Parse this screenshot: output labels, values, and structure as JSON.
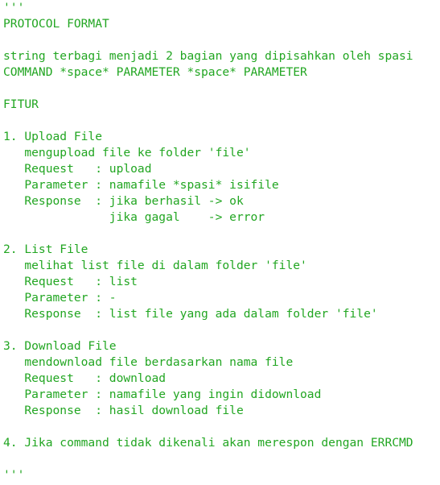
{
  "theme": {
    "text_color": "#22a622",
    "background": "#ffffff"
  },
  "fence_open": "'''",
  "title": "PROTOCOL FORMAT",
  "intro": {
    "line1": "string terbagi menjadi 2 bagian yang dipisahkan oleh spasi",
    "line2": "COMMAND *space* PARAMETER *space* PARAMETER"
  },
  "fitur_heading": "FITUR",
  "features": [
    {
      "heading": "1. Upload File",
      "description": "   mengupload file ke folder 'file'",
      "request": "   Request   : upload",
      "parameter": "   Parameter : namafile *spasi* isifile",
      "response": "   Response  : jika berhasil -> ok",
      "response_extra": "               jika gagal    -> error"
    },
    {
      "heading": "2. List File",
      "description": "   melihat list file di dalam folder 'file'",
      "request": "   Request   : list",
      "parameter": "   Parameter : -",
      "response": "   Response  : list file yang ada dalam folder 'file'"
    },
    {
      "heading": "3. Download File",
      "description": "   mendownload file berdasarkan nama file",
      "request": "   Request   : download",
      "parameter": "   Parameter : namafile yang ingin didownload",
      "response": "   Response  : hasil download file"
    }
  ],
  "note": "4. Jika command tidak dikenali akan merespon dengan ERRCMD",
  "fence_close": "'''"
}
